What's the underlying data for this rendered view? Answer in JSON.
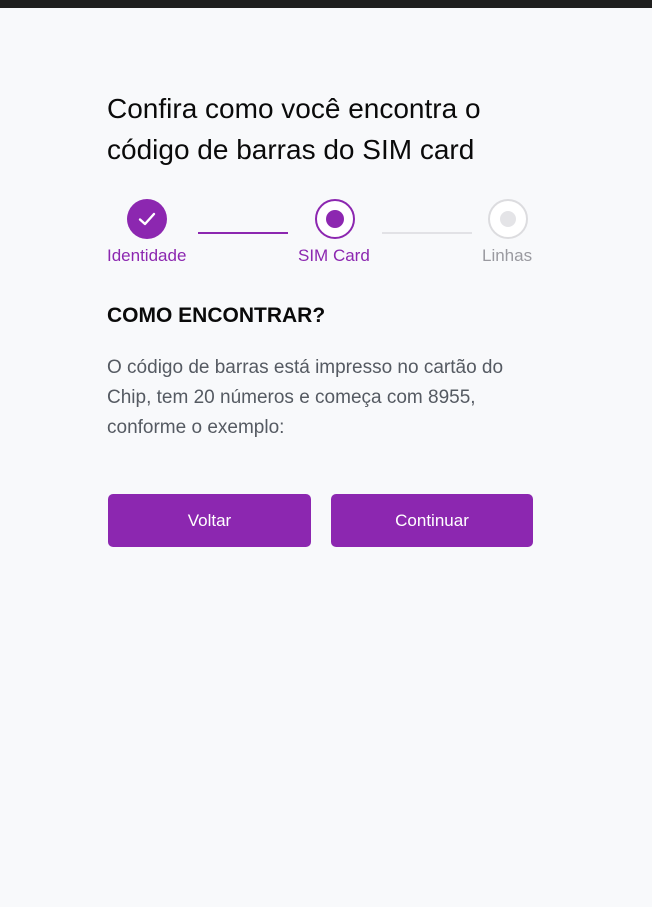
{
  "page": {
    "title": "Confira como você encontra o código de barras do SIM card"
  },
  "stepper": {
    "steps": [
      {
        "label": "Identidade",
        "state": "completed",
        "icon": "check-icon"
      },
      {
        "label": "SIM Card",
        "state": "current",
        "icon": "dot-icon"
      },
      {
        "label": "Linhas",
        "state": "pending",
        "icon": "dot-icon"
      }
    ]
  },
  "section": {
    "title": "COMO ENCONTRAR?",
    "description": "O código de barras está impresso no cartão do Chip, tem 20 números e começa com 8955, conforme o exemplo:"
  },
  "actions": {
    "back_label": "Voltar",
    "continue_label": "Continuar"
  },
  "colors": {
    "accent": "#8c27b0",
    "pending": "#9a9aa0",
    "text_primary": "#0a0a0a",
    "text_secondary": "#555a62",
    "background": "#f8f9fb"
  }
}
